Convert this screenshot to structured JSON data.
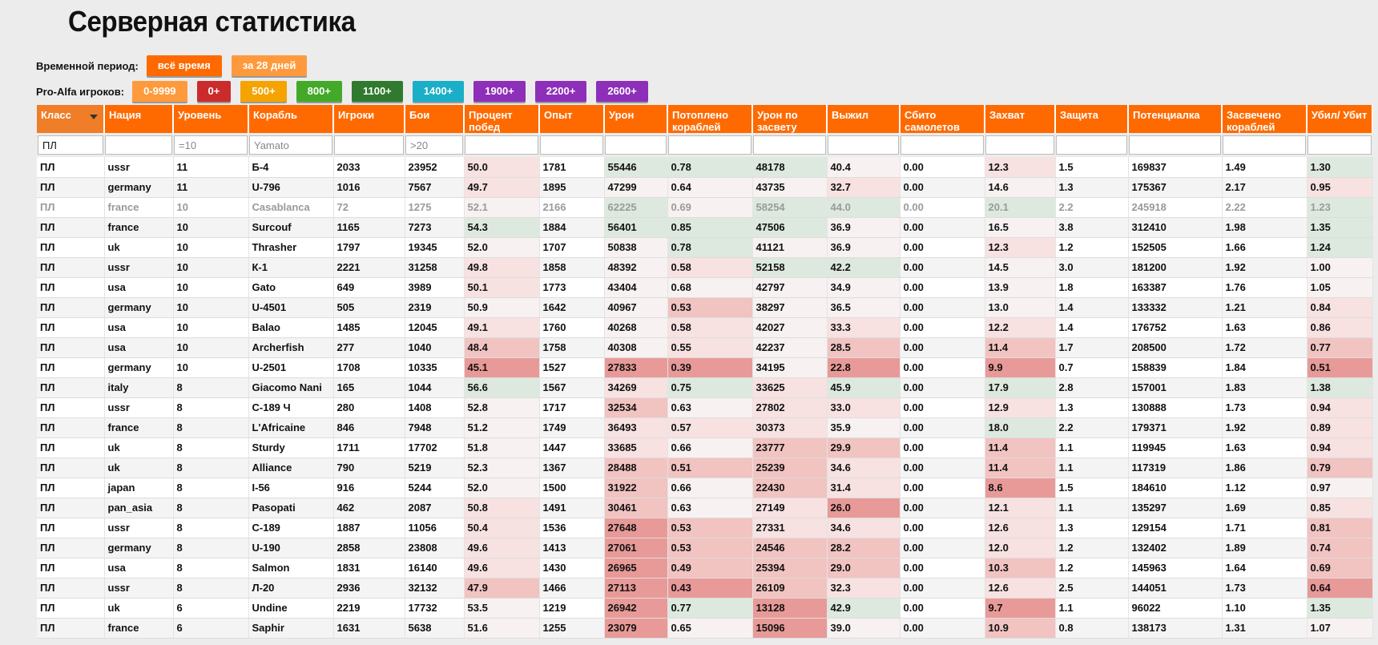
{
  "title": "Серверная статистика",
  "period": {
    "label": "Временной период:",
    "buttons": [
      {
        "label": "всё время",
        "color": "#ff6a00"
      },
      {
        "label": "за 28 дней",
        "color": "#ff9a3c"
      }
    ]
  },
  "pro": {
    "label": "Pro-Alfa игроков:",
    "buttons": [
      {
        "label": "0-9999",
        "color": "#ff9a3c"
      },
      {
        "label": "0+",
        "color": "#cc2b2b"
      },
      {
        "label": "500+",
        "color": "#f5a300"
      },
      {
        "label": "800+",
        "color": "#43a929"
      },
      {
        "label": "1100+",
        "color": "#2f7a2e"
      },
      {
        "label": "1400+",
        "color": "#1aaec8"
      },
      {
        "label": "1900+",
        "color": "#8d2fb8"
      },
      {
        "label": "2200+",
        "color": "#8d2fb8"
      },
      {
        "label": "2600+",
        "color": "#8d2fb8"
      }
    ]
  },
  "colors": {
    "header": "#ff6a00",
    "bad_strong": "#e89a98",
    "bad_mid": "#f1c3c1",
    "bad_light": "#f7e2e1",
    "good_light": "#dde9df",
    "neutral": "#f7f1f1"
  },
  "table": {
    "columns": [
      "Класс",
      "Нация",
      "Уровень",
      "Корабль",
      "Игроки",
      "Бои",
      "Процент побед",
      "Опыт",
      "Урон",
      "Потоплено кораблей",
      "Урон по засвету",
      "Выжил",
      "Сбито самолетов",
      "Захват",
      "Защита",
      "Потенциалка",
      "Засвечено кораблей",
      "Убил/ Убит"
    ],
    "filters": [
      {
        "value": "ПЛ",
        "placeholder": ""
      },
      {
        "value": "",
        "placeholder": ""
      },
      {
        "value": "",
        "placeholder": "=10"
      },
      {
        "value": "",
        "placeholder": "Yamato"
      },
      {
        "value": "",
        "placeholder": ""
      },
      {
        "value": "",
        "placeholder": ">20"
      },
      {
        "value": "",
        "placeholder": ""
      },
      {
        "value": "",
        "placeholder": ""
      },
      {
        "value": "",
        "placeholder": ""
      },
      {
        "value": "",
        "placeholder": ""
      },
      {
        "value": "",
        "placeholder": ""
      },
      {
        "value": "",
        "placeholder": ""
      },
      {
        "value": "",
        "placeholder": ""
      },
      {
        "value": "",
        "placeholder": ""
      },
      {
        "value": "",
        "placeholder": ""
      },
      {
        "value": "",
        "placeholder": ""
      },
      {
        "value": "",
        "placeholder": ""
      },
      {
        "value": "",
        "placeholder": ""
      }
    ],
    "rows": [
      [
        "ПЛ",
        "ussr",
        "11",
        "Б-4",
        "2033",
        "23952",
        "50.0",
        "1781",
        "55446",
        "0.78",
        "48178",
        "40.4",
        "0.00",
        "12.3",
        "1.5",
        "169837",
        "1.49",
        "1.30"
      ],
      [
        "ПЛ",
        "germany",
        "11",
        "U-796",
        "1016",
        "7567",
        "49.7",
        "1895",
        "47299",
        "0.64",
        "43735",
        "32.7",
        "0.00",
        "14.6",
        "1.3",
        "175367",
        "2.17",
        "0.95"
      ],
      [
        "ПЛ",
        "france",
        "10",
        "Casablanca",
        "72",
        "1275",
        "52.1",
        "2166",
        "62225",
        "0.69",
        "58254",
        "44.0",
        "0.00",
        "20.1",
        "2.2",
        "245918",
        "2.22",
        "1.23"
      ],
      [
        "ПЛ",
        "france",
        "10",
        "Surcouf",
        "1165",
        "7273",
        "54.3",
        "1884",
        "56401",
        "0.85",
        "47506",
        "36.9",
        "0.00",
        "16.5",
        "3.8",
        "312410",
        "1.98",
        "1.35"
      ],
      [
        "ПЛ",
        "uk",
        "10",
        "Thrasher",
        "1797",
        "19345",
        "52.0",
        "1707",
        "50838",
        "0.78",
        "41121",
        "36.9",
        "0.00",
        "12.3",
        "1.2",
        "152505",
        "1.66",
        "1.24"
      ],
      [
        "ПЛ",
        "ussr",
        "10",
        "К-1",
        "2221",
        "31258",
        "49.8",
        "1858",
        "48392",
        "0.58",
        "52158",
        "42.2",
        "0.00",
        "14.5",
        "3.0",
        "181200",
        "1.92",
        "1.00"
      ],
      [
        "ПЛ",
        "usa",
        "10",
        "Gato",
        "649",
        "3989",
        "50.1",
        "1773",
        "43404",
        "0.68",
        "42797",
        "34.9",
        "0.00",
        "13.9",
        "1.8",
        "163387",
        "1.76",
        "1.05"
      ],
      [
        "ПЛ",
        "germany",
        "10",
        "U-4501",
        "505",
        "2319",
        "50.9",
        "1642",
        "40967",
        "0.53",
        "38297",
        "36.5",
        "0.00",
        "13.0",
        "1.4",
        "133332",
        "1.21",
        "0.84"
      ],
      [
        "ПЛ",
        "usa",
        "10",
        "Balao",
        "1485",
        "12045",
        "49.1",
        "1760",
        "40268",
        "0.58",
        "42027",
        "33.3",
        "0.00",
        "12.2",
        "1.4",
        "176752",
        "1.63",
        "0.86"
      ],
      [
        "ПЛ",
        "usa",
        "10",
        "Archerfish",
        "277",
        "1040",
        "48.4",
        "1758",
        "40308",
        "0.55",
        "42237",
        "28.5",
        "0.00",
        "11.4",
        "1.7",
        "208500",
        "1.72",
        "0.77"
      ],
      [
        "ПЛ",
        "germany",
        "10",
        "U-2501",
        "1708",
        "10335",
        "45.1",
        "1527",
        "27833",
        "0.39",
        "34195",
        "22.8",
        "0.00",
        "9.9",
        "0.7",
        "158839",
        "1.84",
        "0.51"
      ],
      [
        "ПЛ",
        "italy",
        "8",
        "Giacomo Nani",
        "165",
        "1044",
        "56.6",
        "1567",
        "34269",
        "0.75",
        "33625",
        "45.9",
        "0.00",
        "17.9",
        "2.8",
        "157001",
        "1.83",
        "1.38"
      ],
      [
        "ПЛ",
        "ussr",
        "8",
        "С-189 Ч",
        "280",
        "1408",
        "52.8",
        "1717",
        "32534",
        "0.63",
        "27802",
        "33.0",
        "0.00",
        "12.9",
        "1.3",
        "130888",
        "1.73",
        "0.94"
      ],
      [
        "ПЛ",
        "france",
        "8",
        "L'Africaine",
        "846",
        "7948",
        "51.2",
        "1749",
        "36493",
        "0.57",
        "30373",
        "35.9",
        "0.00",
        "18.0",
        "2.2",
        "179371",
        "1.92",
        "0.89"
      ],
      [
        "ПЛ",
        "uk",
        "8",
        "Sturdy",
        "1711",
        "17702",
        "51.8",
        "1447",
        "33685",
        "0.66",
        "23777",
        "29.9",
        "0.00",
        "11.4",
        "1.1",
        "119945",
        "1.63",
        "0.94"
      ],
      [
        "ПЛ",
        "uk",
        "8",
        "Alliance",
        "790",
        "5219",
        "52.3",
        "1367",
        "28488",
        "0.51",
        "25239",
        "34.6",
        "0.00",
        "11.4",
        "1.1",
        "117319",
        "1.86",
        "0.79"
      ],
      [
        "ПЛ",
        "japan",
        "8",
        "I-56",
        "916",
        "5244",
        "52.0",
        "1500",
        "31922",
        "0.66",
        "22430",
        "31.4",
        "0.00",
        "8.6",
        "1.5",
        "184610",
        "1.12",
        "0.97"
      ],
      [
        "ПЛ",
        "pan_asia",
        "8",
        "Pasopati",
        "462",
        "2087",
        "50.8",
        "1491",
        "30461",
        "0.63",
        "27149",
        "26.0",
        "0.00",
        "12.1",
        "1.1",
        "135297",
        "1.69",
        "0.85"
      ],
      [
        "ПЛ",
        "ussr",
        "8",
        "С-189",
        "1887",
        "11056",
        "50.4",
        "1536",
        "27648",
        "0.53",
        "27331",
        "34.6",
        "0.00",
        "12.6",
        "1.3",
        "129154",
        "1.71",
        "0.81"
      ],
      [
        "ПЛ",
        "germany",
        "8",
        "U-190",
        "2858",
        "23808",
        "49.6",
        "1413",
        "27061",
        "0.53",
        "24546",
        "28.2",
        "0.00",
        "12.0",
        "1.2",
        "132402",
        "1.89",
        "0.74"
      ],
      [
        "ПЛ",
        "usa",
        "8",
        "Salmon",
        "1831",
        "16140",
        "49.6",
        "1430",
        "26965",
        "0.49",
        "25394",
        "29.0",
        "0.00",
        "10.3",
        "1.2",
        "145963",
        "1.64",
        "0.69"
      ],
      [
        "ПЛ",
        "ussr",
        "8",
        "Л-20",
        "2936",
        "32132",
        "47.9",
        "1466",
        "27113",
        "0.43",
        "26109",
        "32.3",
        "0.00",
        "12.6",
        "2.5",
        "144051",
        "1.73",
        "0.64"
      ],
      [
        "ПЛ",
        "uk",
        "6",
        "Undine",
        "2219",
        "17732",
        "53.5",
        "1219",
        "26942",
        "0.77",
        "13128",
        "42.9",
        "0.00",
        "9.7",
        "1.1",
        "96022",
        "1.10",
        "1.35"
      ],
      [
        "ПЛ",
        "france",
        "6",
        "Saphir",
        "1631",
        "5638",
        "51.6",
        "1255",
        "23079",
        "0.65",
        "15096",
        "39.0",
        "0.00",
        "10.9",
        "0.8",
        "138173",
        "1.31",
        "1.07"
      ]
    ]
  }
}
